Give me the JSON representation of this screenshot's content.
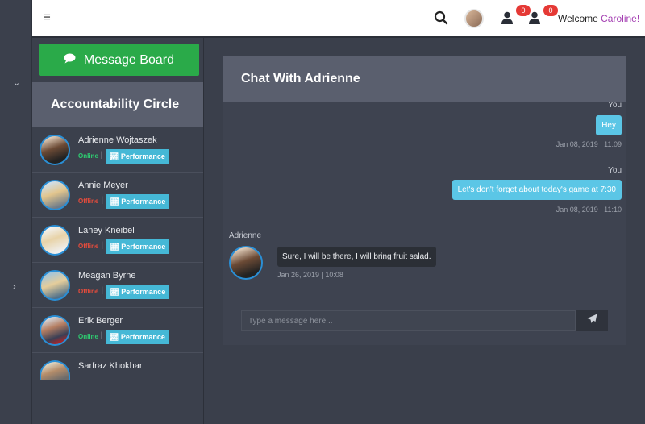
{
  "topbar": {
    "menu_icon": "hamburger-icon",
    "search_icon": "search-icon",
    "notif1_count": "0",
    "notif2_count": "0",
    "welcome_prefix": "Welcome",
    "welcome_name": "Caroline!"
  },
  "sidebar": {
    "message_board_label": "Message Board",
    "circle_title": "Accountability Circle",
    "contacts": [
      {
        "name": "Adrienne Wojtaszek",
        "status": "Online",
        "perf": "Performance"
      },
      {
        "name": "Annie Meyer",
        "status": "Offline",
        "perf": "Performance"
      },
      {
        "name": "Laney Kneibel",
        "status": "Offline",
        "perf": "Performance"
      },
      {
        "name": "Meagan Byrne",
        "status": "Offline",
        "perf": "Performance"
      },
      {
        "name": "Erik Berger",
        "status": "Online",
        "perf": "Performance"
      },
      {
        "name": "Sarfraz Khokhar",
        "status": "",
        "perf": ""
      }
    ]
  },
  "chat": {
    "title": "Chat With Adrienne",
    "messages": [
      {
        "who": "You",
        "text": "Hey",
        "time": "Jan 08, 2019 | 11:09"
      },
      {
        "who": "You",
        "text": "Let's don't forget about today's game at 7:30",
        "time": "Jan 08, 2019 | 11:10"
      },
      {
        "who": "Adrienne",
        "text": "Sure, I will be there, I will bring fruit salad.",
        "time": "Jan 26, 2019 | 10:08"
      }
    ],
    "input_placeholder": "Type a message here..."
  },
  "colors": {
    "accent_green": "#2aaa49",
    "perf_blue": "#45b8d6",
    "online": "#2ecc71",
    "offline": "#e74c3c",
    "welcome_name": "#a43fb2"
  }
}
